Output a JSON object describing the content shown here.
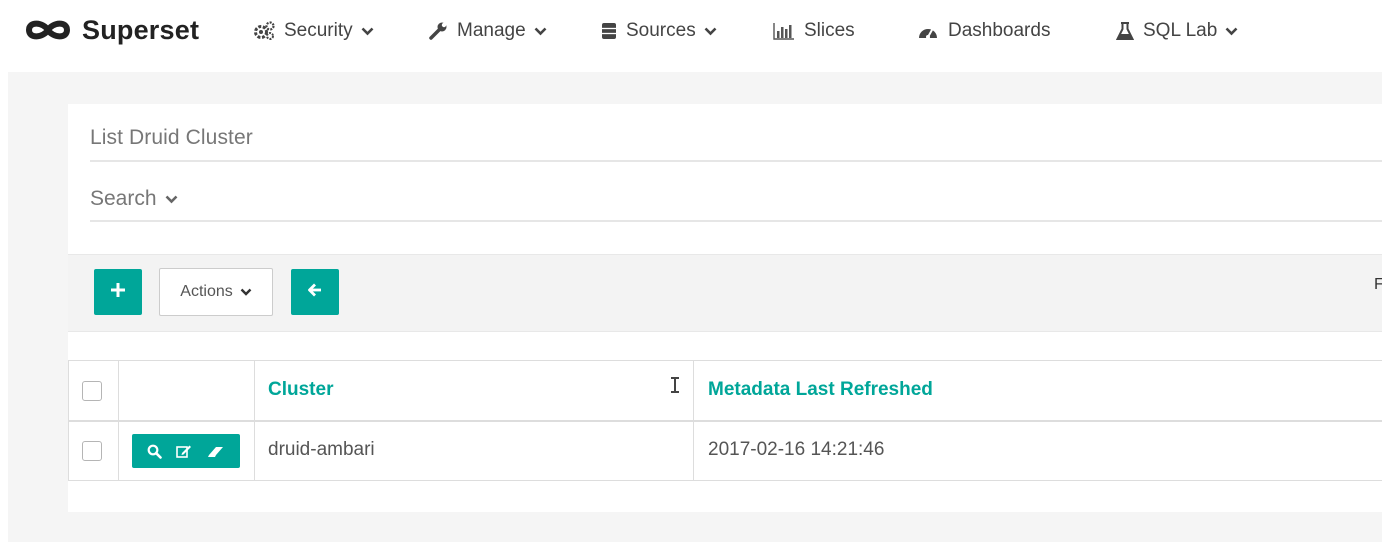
{
  "app": {
    "brand": "Superset"
  },
  "nav": {
    "security": "Security",
    "manage": "Manage",
    "sources": "Sources",
    "slices": "Slices",
    "dashboards": "Dashboards",
    "sql_lab": "SQL Lab"
  },
  "page": {
    "title": "List Druid Cluster",
    "search_label": "Search"
  },
  "toolbar": {
    "actions_label": "Actions",
    "edge_text": "F"
  },
  "table": {
    "columns": [
      "Cluster",
      "Metadata Last Refreshed"
    ],
    "rows": [
      {
        "cluster": "druid-ambari",
        "metadata_last_refreshed": "2017-02-16 14:21:46"
      }
    ]
  },
  "colors": {
    "accent": "#00a699",
    "page_bg": "#f5f5f5"
  },
  "icons": {
    "brand": "infinity-logo-icon",
    "security": "gears-icon",
    "manage": "wrench-icon",
    "sources": "database-icon",
    "slices": "bar-chart-icon",
    "dashboards": "tachometer-icon",
    "sql_lab": "flask-icon"
  }
}
